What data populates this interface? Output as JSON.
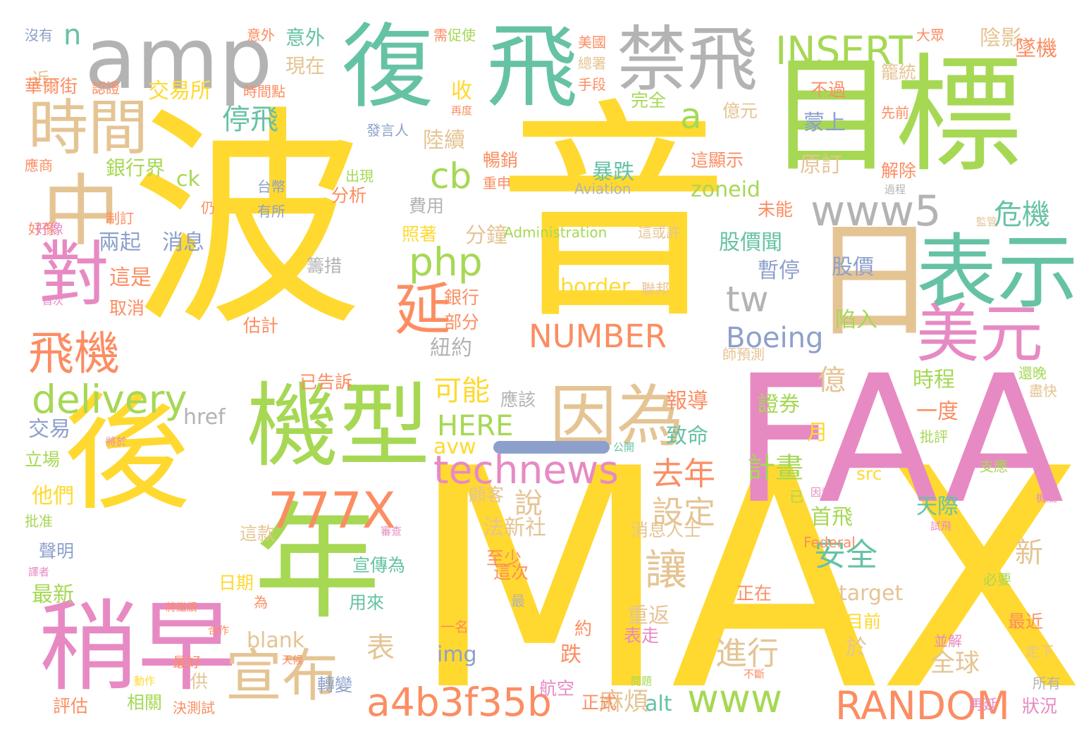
{
  "colors": {
    "background": "#ffffff",
    "yellow": "#ffd92f",
    "green": "#a6d854",
    "teal": "#66c2a5",
    "pink": "#e78ac3",
    "orange": "#fc8d62",
    "blue": "#8da0cb",
    "tan": "#e5c494",
    "gray": "#b3b3b3"
  },
  "words": [
    "波",
    "音",
    "MAX",
    "FAA",
    "目標",
    "日",
    "機型",
    "後",
    "年",
    "稍早",
    "復",
    "飛",
    "禁飛",
    "amp",
    "時間",
    "中",
    "對",
    "表示",
    "美元",
    "因為",
    "飛機",
    "延",
    "777X",
    "technews",
    "宣布",
    "a4b3f35b",
    "RANDOM",
    "www",
    "www5",
    "INSERT",
    "delivery",
    "php",
    "cb",
    "a",
    "tw",
    "NUMBER",
    "HERE",
    "Boeing",
    "zoneid",
    "border",
    "停飛",
    "n",
    "意外",
    "現在",
    "交易所",
    "收",
    "陸續",
    "銀行界",
    "ck",
    "暴跌",
    "蒙上",
    "原訂",
    "危機",
    "股價",
    "股價聞",
    "暫停",
    "億",
    "讓",
    "說",
    "去年",
    "設定",
    "安全",
    "計畫",
    "一度",
    "時程",
    "證券",
    "陷入",
    "首飛",
    "天際",
    "新",
    "進行",
    "表",
    "麻煩",
    "全球",
    "重返",
    "於",
    "target",
    "img",
    "alt",
    "src",
    "href",
    "avw",
    "blank",
    "跌",
    "正式",
    "分鐘",
    "可能",
    "報導",
    "致命",
    "法新社",
    "至少",
    "消息人士",
    "月",
    "顧客",
    "日期",
    "這款",
    "最新",
    "他們",
    "立場",
    "交易",
    "取消",
    "估計",
    "這是",
    "兩起",
    "消息",
    "分析",
    "有所",
    "台幣",
    "費用",
    "照著",
    "籌措",
    "銀行",
    "部分",
    "紐約",
    "應該",
    "已告訴",
    "暢銷",
    "重申",
    "出現",
    "Aviation",
    "Administration",
    "Federal",
    "聯邦",
    "這或許",
    "這顯示",
    "解除",
    "未能",
    "大眾",
    "陰影",
    "墜機",
    "籠統",
    "不過",
    "先前",
    "億元",
    "完全",
    "美國",
    "總署",
    "手段",
    "需",
    "促使",
    "再度",
    "發言人",
    "意外",
    "沒有",
    "近",
    "華爾街",
    "認證",
    "時間點",
    "應商",
    "好像",
    "制訂",
    "首次",
    "仍",
    "聲明",
    "批准",
    "譯者",
    "將於",
    "公開",
    "已",
    "因素",
    "支應",
    "機關",
    "試飛",
    "審查",
    "批評",
    "還晚",
    "盡快",
    "必要",
    "最近",
    "並解",
    "定下",
    "所有",
    "狀況",
    "再延",
    "不斷",
    "問題",
    "天候",
    "最好",
    "將繼續",
    "動作",
    "合作",
    "評估",
    "相關",
    "決測試",
    "一名",
    "最",
    "約",
    "表走",
    "正在",
    "宣傳為",
    "用來",
    "供",
    "轉變",
    "航空",
    "目前",
    "過程",
    "監管",
    "為",
    "這次",
    "師預測",
    "好像"
  ]
}
